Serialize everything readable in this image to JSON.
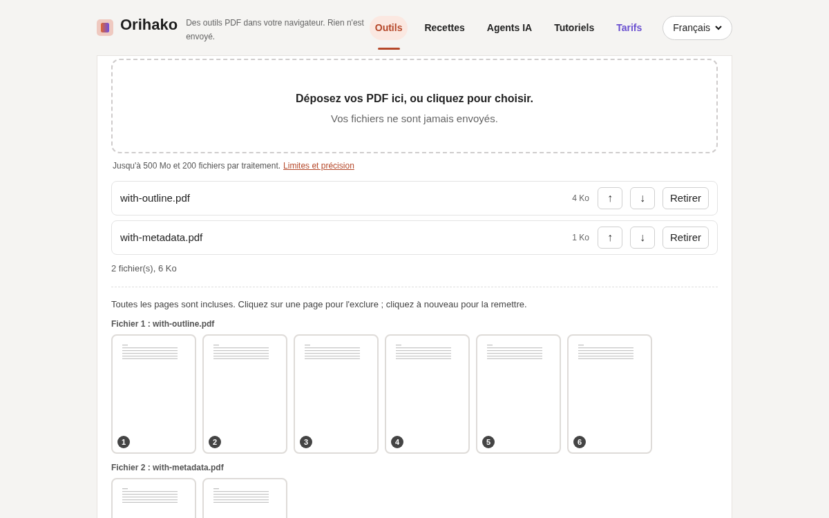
{
  "header": {
    "brand": "Orihako",
    "tagline": "Des outils PDF dans votre navigateur. Rien n'est envoyé.",
    "nav": [
      {
        "label": "Outils",
        "selected": true,
        "kind": "plain"
      },
      {
        "label": "Recettes",
        "selected": false,
        "kind": "plain"
      },
      {
        "label": "Agents IA",
        "selected": false,
        "kind": "plain"
      },
      {
        "label": "Tutoriels",
        "selected": false,
        "kind": "plain"
      },
      {
        "label": "Tarifs",
        "selected": false,
        "kind": "accent"
      }
    ],
    "language_select": {
      "value": "Français"
    }
  },
  "dropzone": {
    "title": "Déposez vos PDF ici, ou cliquez pour choisir.",
    "subtitle": "Vos fichiers ne sont jamais envoyés."
  },
  "limits_note": {
    "text": "Jusqu'à 500 Mo et 200 fichiers par traitement.",
    "link": "Limites et précision"
  },
  "files": [
    {
      "name": "with-outline.pdf",
      "size": "4 Ko",
      "up": "↑",
      "down": "↓",
      "remove": "Retirer"
    },
    {
      "name": "with-metadata.pdf",
      "size": "1 Ko",
      "up": "↑",
      "down": "↓",
      "remove": "Retirer"
    }
  ],
  "summary": "2 fichier(s), 6 Ko",
  "instructions": "Toutes les pages sont incluses. Cliquez sur une page pour l'exclure ; cliquez à nouveau pour la remettre.",
  "documents": [
    {
      "heading": "Fichier 1 : with-outline.pdf",
      "pages": [
        {
          "number": "1",
          "included": true
        },
        {
          "number": "2",
          "included": true
        },
        {
          "number": "3",
          "included": true
        },
        {
          "number": "4",
          "included": true
        },
        {
          "number": "5",
          "included": true
        },
        {
          "number": "6",
          "included": true
        }
      ]
    },
    {
      "heading": "Fichier 2 : with-metadata.pdf",
      "pages": [
        {
          "included": true
        },
        {
          "included": true
        }
      ]
    }
  ]
}
